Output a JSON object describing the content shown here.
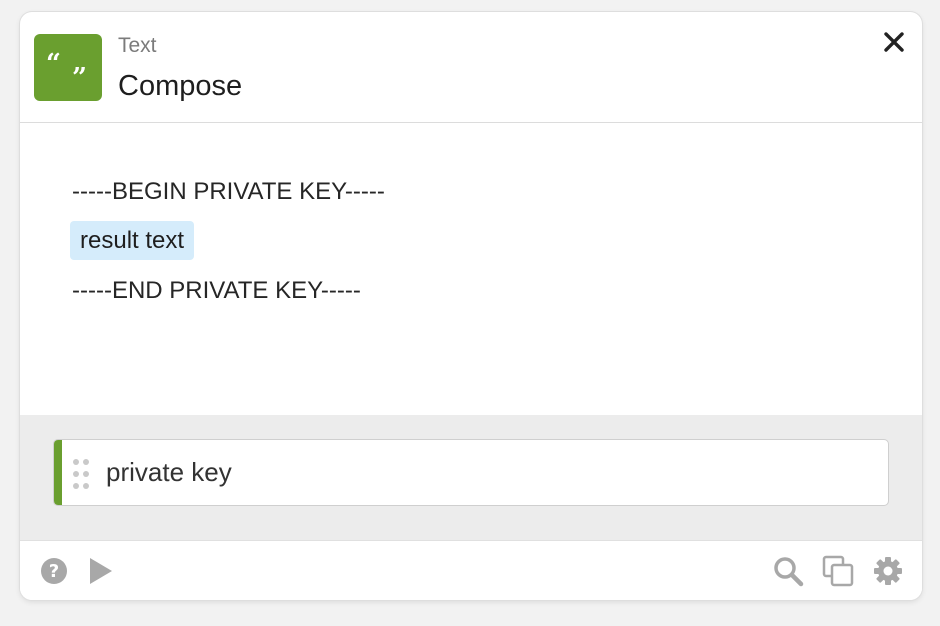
{
  "action": {
    "type_label": "Text",
    "title": "Compose",
    "icon": "quote-icon",
    "accent_color": "#6a9f2f"
  },
  "content": {
    "line_1": "-----BEGIN PRIVATE KEY-----",
    "token_label": "result text",
    "token_color": "#d5ecfb",
    "line_3": "-----END PRIVATE KEY-----"
  },
  "parameter": {
    "value": "private key"
  },
  "footer": {
    "left_icons": [
      "help-icon",
      "play-icon"
    ],
    "right_icons": [
      "search-icon",
      "duplicate-icon",
      "gear-icon"
    ]
  }
}
